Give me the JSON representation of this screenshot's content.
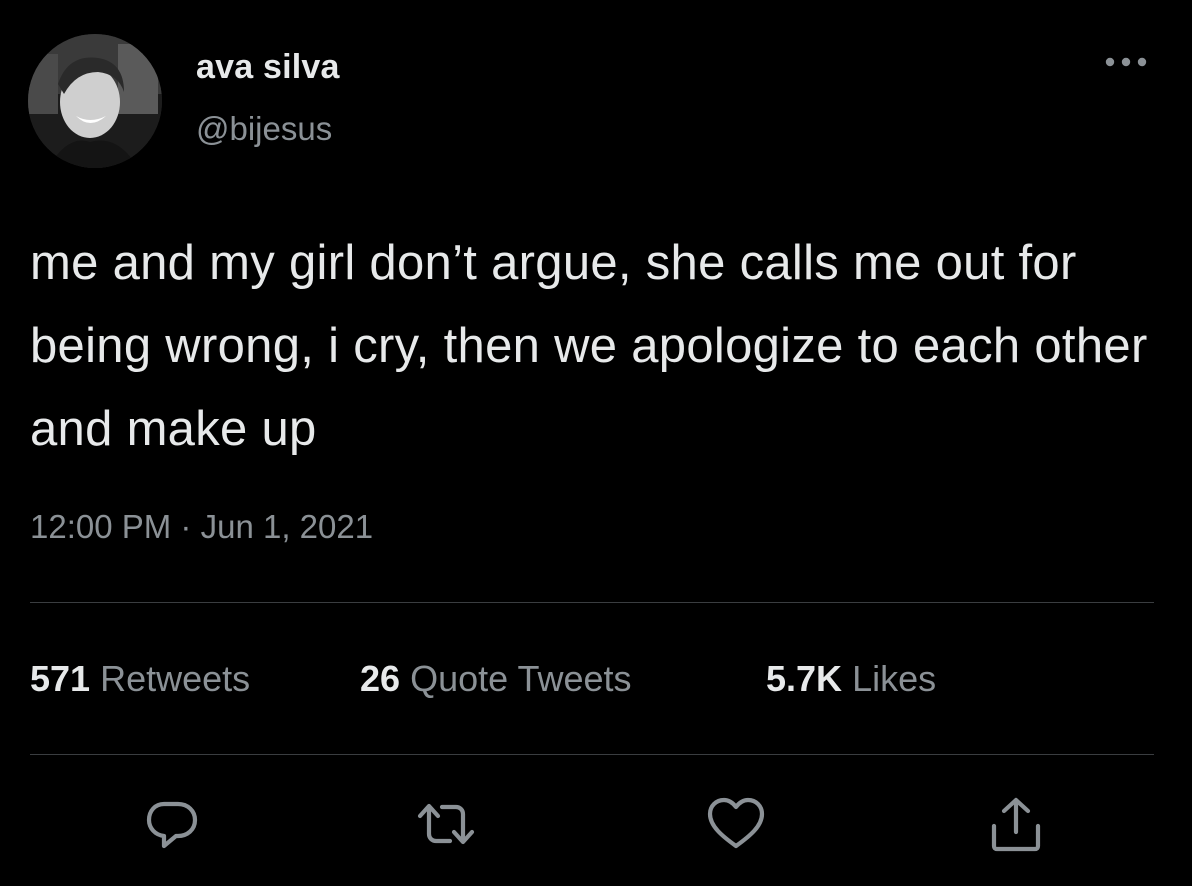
{
  "user": {
    "display_name": "ava silva",
    "handle": "@bijesus",
    "avatar_icon": "profile-photo"
  },
  "tweet": {
    "text": "me and my girl don’t argue, she calls me out for being wrong, i cry, then we apologize to each other and make up",
    "time": "12:00 PM",
    "separator": "·",
    "date": "Jun 1, 2021"
  },
  "stats": {
    "retweets_count": "571",
    "retweets_label": "Retweets",
    "quotes_count": "26",
    "quotes_label": "Quote Tweets",
    "likes_count": "5.7K",
    "likes_label": "Likes"
  },
  "actions": {
    "reply_icon": "reply-icon",
    "retweet_icon": "retweet-icon",
    "like_icon": "heart-icon",
    "share_icon": "share-icon",
    "more_icon": "more-icon"
  },
  "colors": {
    "background": "#000000",
    "primary_text": "#e7e9ea",
    "secondary_text": "#8b9196",
    "divider": "#3a3d40"
  }
}
